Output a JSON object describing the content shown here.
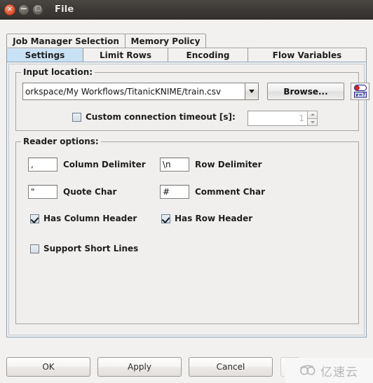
{
  "window": {
    "title": "File",
    "controls": {
      "close": "close-icon",
      "minimize": "minimize-icon",
      "maximize": "maximize-icon",
      "close_glyph": "×",
      "minimize_glyph": "−",
      "maximize_glyph": "□"
    }
  },
  "tabs": {
    "row1": [
      {
        "label": "Job Manager Selection",
        "selected": false
      },
      {
        "label": "Memory Policy",
        "selected": false
      }
    ],
    "row2": [
      {
        "label": "Settings",
        "selected": true
      },
      {
        "label": "Limit Rows",
        "selected": false
      },
      {
        "label": "Encoding",
        "selected": false
      },
      {
        "label": "Flow Variables",
        "selected": false
      }
    ]
  },
  "input_location": {
    "group_title": "Input location:",
    "path_value": "orkspace/My Workflows/TitanicKNIME/train.csv",
    "dropdown_icon": "chevron-down-icon",
    "browse_label": "Browse...",
    "flow_variable_icon": "flow-variable-icon",
    "flow_variable_glyph": "v=?",
    "timeout_label": "Custom connection timeout [s]:",
    "timeout_checked": false,
    "timeout_value": "1"
  },
  "reader_options": {
    "group_title": "Reader options:",
    "column_delimiter": {
      "label": "Column Delimiter",
      "value": ","
    },
    "row_delimiter": {
      "label": "Row Delimiter",
      "value": "\\n"
    },
    "quote_char": {
      "label": "Quote Char",
      "value": "\""
    },
    "comment_char": {
      "label": "Comment Char",
      "value": "#"
    },
    "has_column_header": {
      "label": "Has Column Header",
      "checked": true
    },
    "has_row_header": {
      "label": "Has Row Header",
      "checked": true
    },
    "support_short_lines": {
      "label": "Support Short Lines",
      "checked": false
    }
  },
  "buttons": {
    "ok": "OK",
    "apply": "Apply",
    "cancel": "Cancel",
    "help_icon": "help-circle-icon",
    "help_glyph": "?"
  },
  "watermark": {
    "text": "亿速云",
    "logo_icon": "cloud-logo-icon"
  },
  "colors": {
    "titlebar": "#3c3936",
    "selected_tab": "#c9e1f4",
    "panel_bg": "#f0efee",
    "accent_border": "#8aa4bd",
    "close_button": "#e8633a"
  }
}
